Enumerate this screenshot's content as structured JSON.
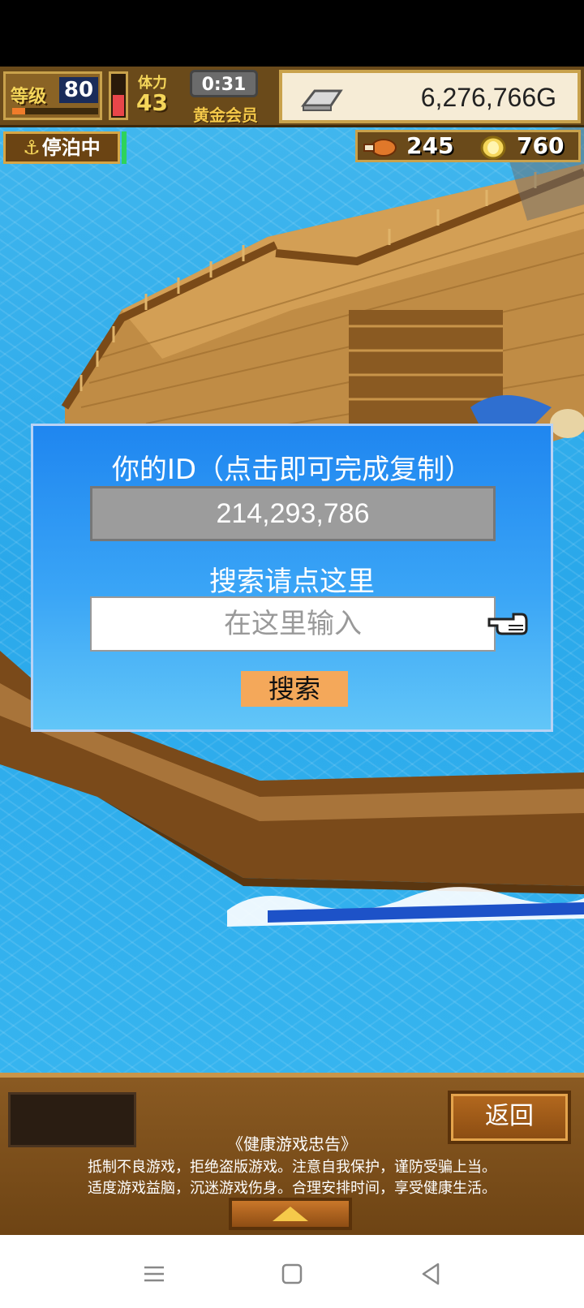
{
  "hud": {
    "level_label": "等级",
    "level": "80",
    "level_progress": 0.15,
    "stamina_label": "体力",
    "stamina": "43",
    "stamina_level": 0.55,
    "timer": "0:31",
    "membership": "黄金会员",
    "gold": "6,276,766G",
    "docked_status": "停泊中",
    "meat_count": "245",
    "medal_count": "760"
  },
  "dialog": {
    "title": "你的ID（点击即可完成复制）",
    "user_id": "214,293,786",
    "search_hint": "搜索请点这里",
    "input_placeholder": "在这里输入",
    "search_button": "搜索"
  },
  "bottom": {
    "back_button": "返回",
    "notice_title": "《健康游戏忠告》",
    "notice_line1": "抵制不良游戏，拒绝盗版游戏。注意自我保护，谨防受骗上当。",
    "notice_line2": "适度游戏益脑，沉迷游戏伤身。合理安排时间，享受健康生活。"
  },
  "colors": {
    "dialog_top": "#1f86f0",
    "dialog_bottom": "#62c6f8",
    "search_button": "#f4a85a",
    "sea": "#2aa8ea",
    "wood": "#b9873e"
  }
}
